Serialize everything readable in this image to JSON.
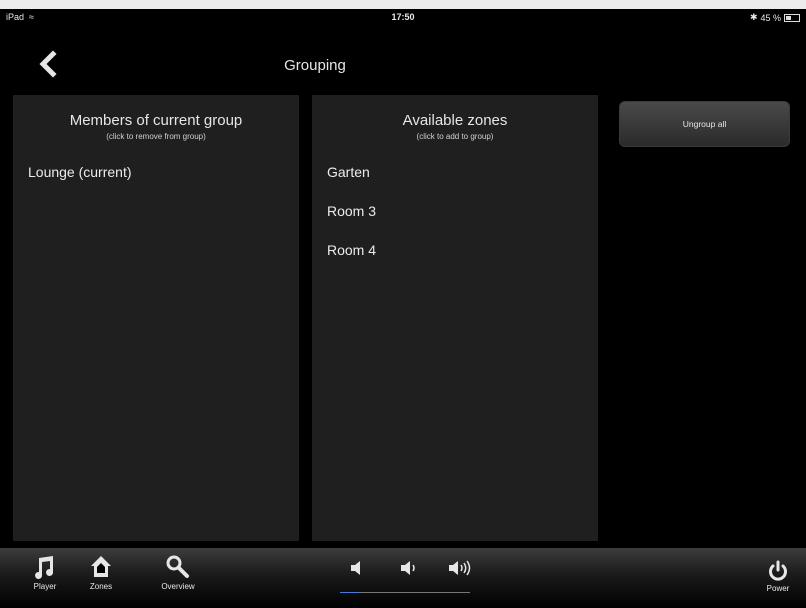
{
  "status": {
    "device": "iPad",
    "time": "17:50",
    "battery_text": "45 %",
    "battery_level": 0.45
  },
  "header": {
    "title": "Grouping"
  },
  "members": {
    "title": "Members of current group",
    "subtitle": "(click to remove from group)",
    "items": [
      "Lounge (current)"
    ]
  },
  "available": {
    "title": "Available zones",
    "subtitle": "(click to add to group)",
    "items": [
      "Garten",
      "Room 3",
      "Room 4"
    ]
  },
  "actions": {
    "ungroup_label": "Ungroup all"
  },
  "toolbar": {
    "player": "Player",
    "zones": "Zones",
    "overview": "Overview",
    "power": "Power",
    "volume_level": 0.15
  },
  "colors": {
    "background": "#000000",
    "panel": "#1f1f1f",
    "text": "#e6e6e6",
    "accent": "#4a78d8"
  }
}
